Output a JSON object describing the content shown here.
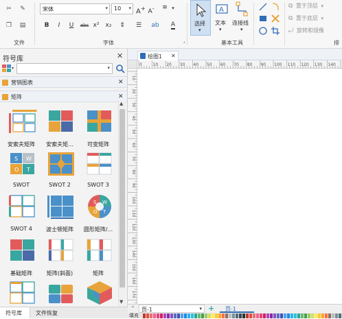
{
  "ribbon": {
    "font_name": "宋体",
    "font_size": "10",
    "group_file": "文件",
    "group_font": "字体",
    "group_basic_tools": "基本工具",
    "group_arrange": "排",
    "select_label": "选择",
    "text_label": "文本",
    "connector_label": "连接线",
    "bring_to_front": "置于顶层",
    "send_to_back": "置于底层",
    "rotate_mirror": "旋转和镜像",
    "bold": "B",
    "italic": "I",
    "underline": "U",
    "strikethrough": "abc",
    "superscript": "x²",
    "subscript": "x₂",
    "grow_font": "A",
    "shrink_font": "A",
    "font_color": "A"
  },
  "sidebar": {
    "title": "符号库",
    "search_placeholder": "",
    "categories": [
      "营销图表",
      "矩阵"
    ],
    "shapes": [
      {
        "label": "安索夫矩阵"
      },
      {
        "label": "安索夫矩..."
      },
      {
        "label": "可变矩阵"
      },
      {
        "label": "SWOT"
      },
      {
        "label": "SWOT 2"
      },
      {
        "label": "SWOT 3"
      },
      {
        "label": "SWOT 4"
      },
      {
        "label": "波士顿矩阵"
      },
      {
        "label": "圆形矩阵/..."
      },
      {
        "label": "基础矩阵"
      },
      {
        "label": "矩阵(斜面)"
      },
      {
        "label": "矩阵"
      },
      {
        "label": ""
      },
      {
        "label": ""
      },
      {
        "label": ""
      }
    ],
    "bottom_tabs": [
      "符号库",
      "文件恢复"
    ]
  },
  "document": {
    "tab_title": "绘图1",
    "ruler_h": [
      "0",
      "10",
      "20",
      "30",
      "40",
      "50",
      "60",
      "70",
      "80",
      "90",
      "100",
      "110",
      "120",
      "130",
      "140",
      "150"
    ],
    "ruler_v": [
      "10",
      "20",
      "30",
      "40",
      "50",
      "60",
      "70",
      "80",
      "90",
      "100",
      "110",
      "120",
      "130",
      "140",
      "150",
      "160",
      "170"
    ],
    "page_selector": "页-1",
    "page_tab": "页-1",
    "fill_label": "填充"
  },
  "colors": {
    "accent": "#2f6db5",
    "orange": "#e8a33a",
    "teal": "#3aa6a0",
    "red": "#e25b5b",
    "blue_shape": "#4a90c9"
  }
}
